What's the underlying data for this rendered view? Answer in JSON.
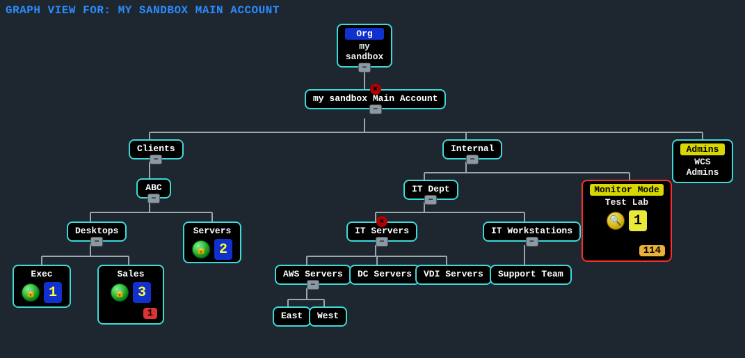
{
  "page_title": "GRAPH VIEW FOR: MY SANDBOX MAIN ACCOUNT",
  "collapse_glyph": "−",
  "close_glyph": "✖",
  "nodes": {
    "org": {
      "title": "Org",
      "sub": "my sandbox"
    },
    "main": {
      "label": "my sandbox Main Account"
    },
    "clients": {
      "label": "Clients"
    },
    "internal": {
      "label": "Internal"
    },
    "admins": {
      "title": "Admins",
      "sub": "WCS Admins"
    },
    "monitor": {
      "title": "Monitor Mode",
      "sub": "Test Lab",
      "count": "1",
      "pill": "114"
    },
    "abc": {
      "label": "ABC"
    },
    "desktops": {
      "label": "Desktops"
    },
    "servers": {
      "label": "Servers",
      "count": "2"
    },
    "exec": {
      "label": "Exec",
      "count": "1"
    },
    "sales": {
      "label": "Sales",
      "count": "3",
      "pill": "1"
    },
    "itdept": {
      "label": "IT Dept"
    },
    "itservers": {
      "label": "IT Servers"
    },
    "itworkstations": {
      "label": "IT Workstations"
    },
    "aws": {
      "label": "AWS Servers"
    },
    "dc": {
      "label": "DC Servers"
    },
    "vdi": {
      "label": "VDI Servers"
    },
    "support": {
      "label": "Support Team"
    },
    "east": {
      "label": "East"
    },
    "west": {
      "label": "West"
    }
  }
}
